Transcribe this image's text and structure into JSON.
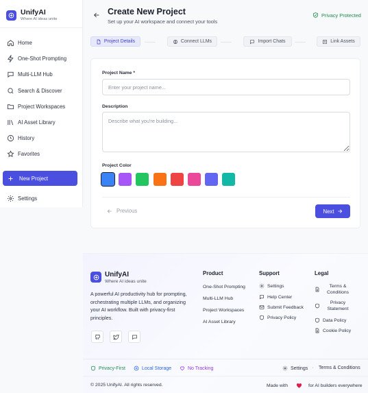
{
  "app": {
    "name": "UnifyAI",
    "tagline": "Where AI ideas unite"
  },
  "sidebar": {
    "items": [
      {
        "label": "Home",
        "icon": "home-icon"
      },
      {
        "label": "One-Shot Prompting",
        "icon": "zap-icon"
      },
      {
        "label": "Multi-LLM Hub",
        "icon": "message-icon"
      },
      {
        "label": "Search & Discover",
        "icon": "search-icon"
      },
      {
        "label": "Project Workspaces",
        "icon": "folder-icon"
      },
      {
        "label": "AI Asset Library",
        "icon": "library-icon"
      },
      {
        "label": "History",
        "icon": "clock-icon"
      },
      {
        "label": "Favorites",
        "icon": "star-icon"
      }
    ],
    "new_project": "New Project",
    "settings": "Settings"
  },
  "header": {
    "title": "Create New Project",
    "subtitle": "Set up your AI workspace and connect your tools",
    "privacy": "Privacy Protected"
  },
  "steps": [
    {
      "label": "Project Details",
      "icon": "file-icon",
      "active": true
    },
    {
      "label": "Connect LLMs",
      "icon": "brain-icon",
      "active": false
    },
    {
      "label": "Import Chats",
      "icon": "chat-icon",
      "active": false
    },
    {
      "label": "Link Assets",
      "icon": "archive-icon",
      "active": false
    }
  ],
  "form": {
    "name_label": "Project Name *",
    "name_placeholder": "Enter your project name...",
    "name_value": "",
    "desc_label": "Description",
    "desc_placeholder": "Describe what you're building...",
    "desc_value": "",
    "color_label": "Project Color",
    "colors": [
      "#3b82f6",
      "#a855f7",
      "#22c55e",
      "#f97316",
      "#ef4444",
      "#ec4899",
      "#6366f1",
      "#14b8a6"
    ],
    "selected_color": "#3b82f6",
    "previous": "Previous",
    "next": "Next"
  },
  "footer": {
    "brand": "UnifyAI",
    "tagline": "Where AI ideas unite",
    "description": "A powerful AI productivity hub for prompting, orchestrating multiple LLMs, and organizing your AI workflow. Built with privacy-first principles.",
    "product_title": "Product",
    "product_links": [
      "One-Shot Prompting",
      "Multi-LLM Hub",
      "Project Workspaces",
      "AI Asset Library"
    ],
    "support_title": "Support",
    "support_links": [
      "Settings",
      "Help Center",
      "Submit Feedback",
      "Privacy Policy"
    ],
    "legal_title": "Legal",
    "legal_links": [
      "Terms & Conditions",
      "Privacy Statement",
      "Data Policy",
      "Cookie Policy"
    ],
    "badges": [
      "Privacy-First",
      "Local Storage",
      "No Tracking"
    ],
    "bottom_settings": "Settings",
    "bottom_dot": "·",
    "bottom_terms": "Terms & Conditions",
    "copyright": "© 2025 UnifyAI. All rights reserved.",
    "made_with": "Made with",
    "made_for": "for AI builders everywhere"
  },
  "colors": {
    "accent": "#4a4fe0",
    "privacy_green": "#1f8a4c",
    "badge_green": "#1f8a4c",
    "badge_blue": "#2563eb",
    "badge_purple": "#9333ea",
    "heart": "#e11d48"
  }
}
